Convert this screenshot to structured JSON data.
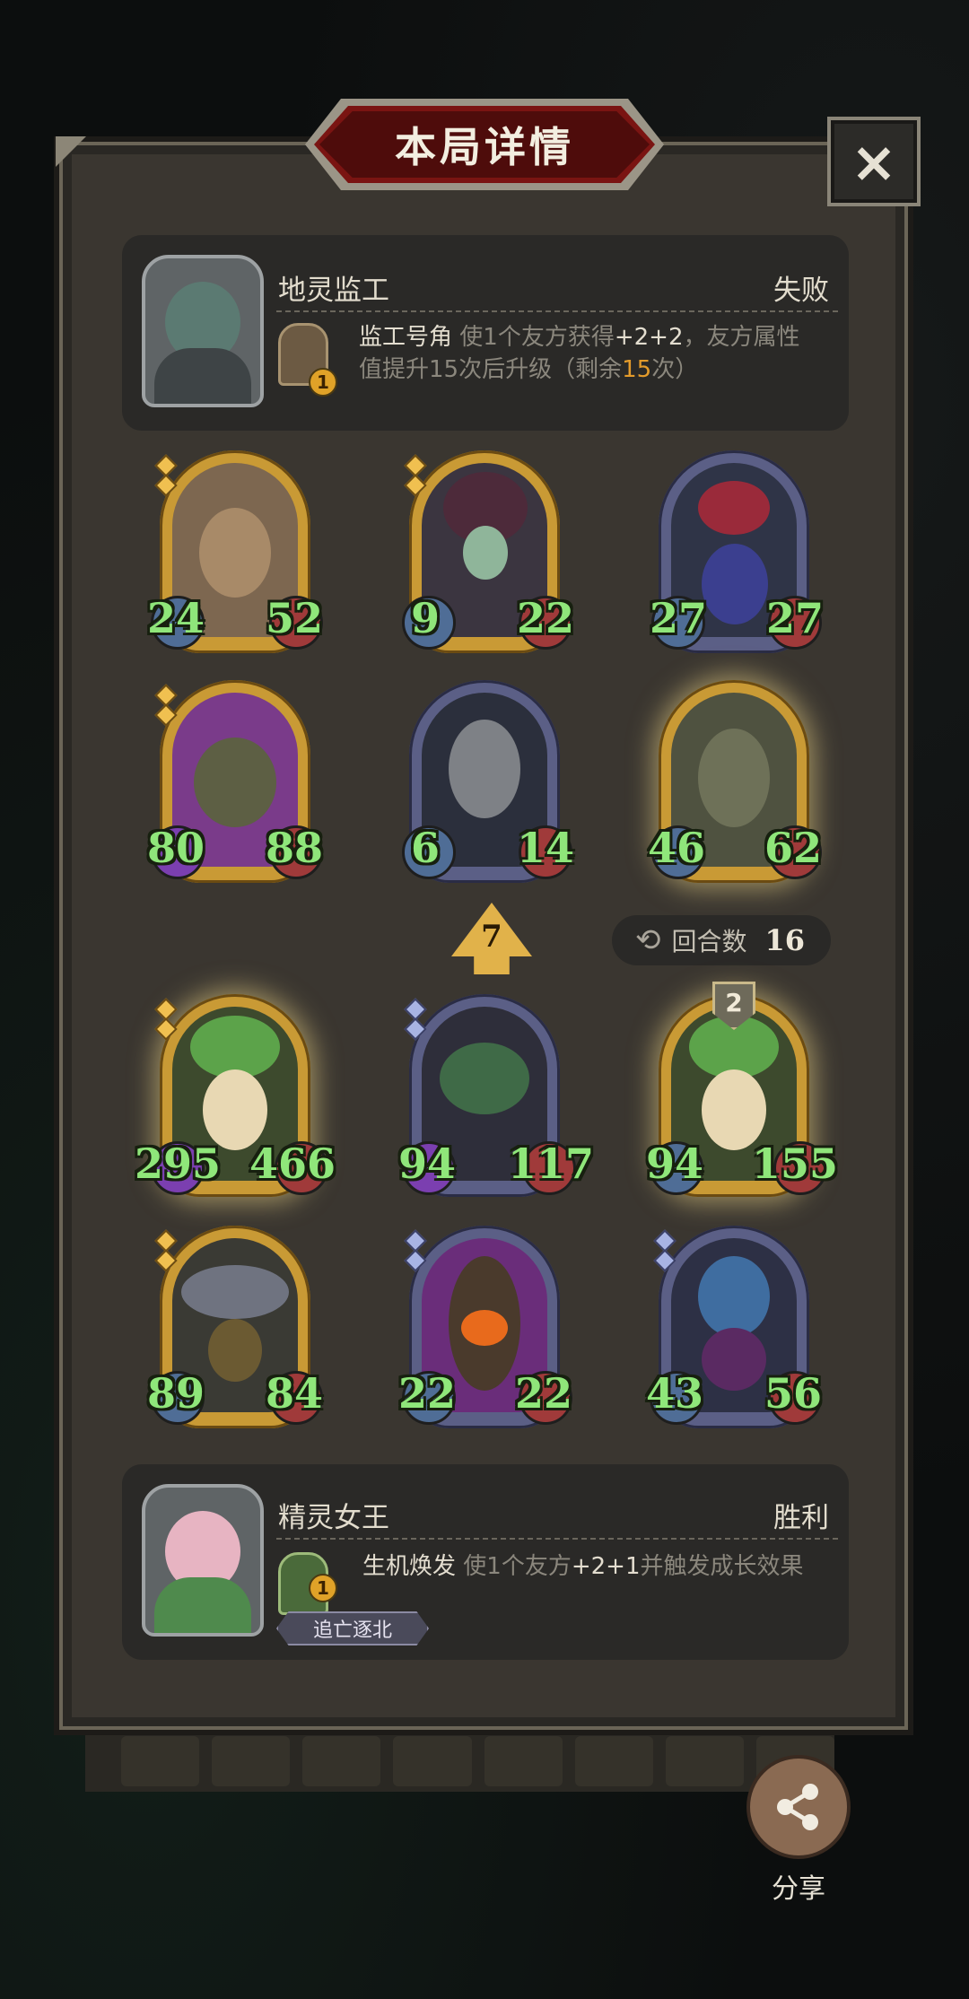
{
  "title": "本局详情",
  "close_icon": "×",
  "opponent": {
    "name": "地灵监工",
    "result": "失败",
    "skill": {
      "level": "1",
      "name": "监工号角",
      "desc_prefix": "使1个友方获得",
      "desc_bonus": "+2+2",
      "desc_mid": "，友方属性",
      "desc_line2_a": "值提升15次后升级（剩余",
      "desc_remaining": "15",
      "desc_line2_b": "次）"
    }
  },
  "enemy_board": [
    {
      "atk": "24",
      "hp": "52"
    },
    {
      "atk": "9",
      "hp": "22"
    },
    {
      "atk": "27",
      "hp": "27"
    },
    {
      "atk": "80",
      "hp": "88"
    },
    {
      "atk": "6",
      "hp": "14"
    },
    {
      "atk": "46",
      "hp": "62"
    }
  ],
  "turn_marker": "7",
  "round": {
    "label": "回合数",
    "value": "16"
  },
  "player_board": [
    {
      "atk": "295",
      "hp": "466"
    },
    {
      "atk": "94",
      "hp": "117"
    },
    {
      "atk": "94",
      "hp": "155",
      "level": "2"
    },
    {
      "atk": "89",
      "hp": "84"
    },
    {
      "atk": "22",
      "hp": "22"
    },
    {
      "atk": "43",
      "hp": "56"
    }
  ],
  "player": {
    "name": "精灵女王",
    "result": "胜利",
    "tag": "追亡逐北",
    "skill": {
      "level": "1",
      "name": "生机焕发",
      "desc_a": "使1个友方",
      "desc_bonus": "+2+1",
      "desc_b": "并触发成长效果"
    }
  },
  "share": {
    "label": "分享",
    "icon": "share-icon"
  },
  "colors": {
    "stat_green": "#8fe67a",
    "title_red": "#7a1412",
    "gold_frame": "#c99a35",
    "blue_frame": "#5b5f86"
  }
}
